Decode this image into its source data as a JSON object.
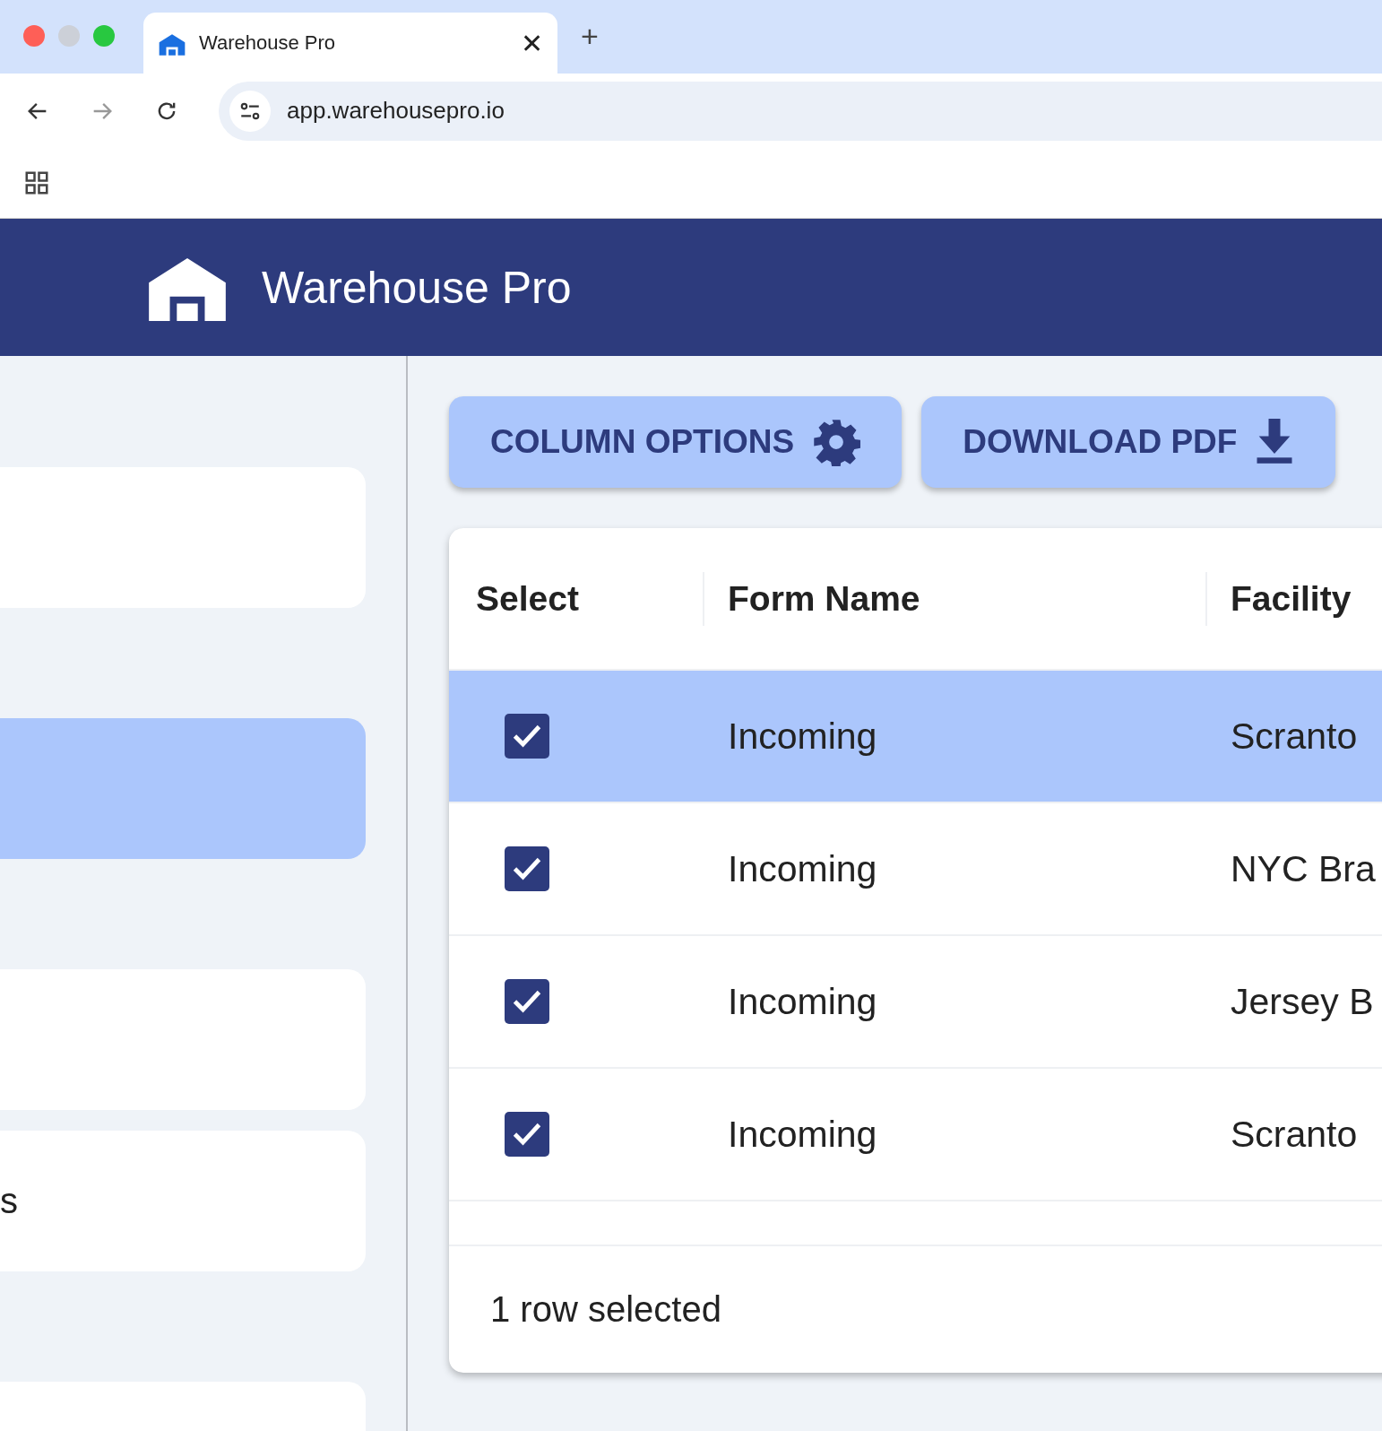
{
  "browser": {
    "tab": {
      "title": "Warehouse Pro",
      "close": "✕"
    },
    "new_tab": "+",
    "url": "app.warehousepro.io"
  },
  "header": {
    "title": "Warehouse Pro"
  },
  "sidebar": {
    "items": [
      {
        "selected": false
      },
      {
        "selected": true
      },
      {
        "selected": false
      },
      {
        "label": "s",
        "selected": false
      },
      {
        "selected": false
      }
    ]
  },
  "toolbar": {
    "buttons": [
      {
        "label": "COLUMN OPTIONS",
        "kind": "settings"
      },
      {
        "label": "DOWNLOAD PDF",
        "kind": "download"
      }
    ]
  },
  "table": {
    "columns": [
      "Select",
      "Form Name",
      "Facility"
    ],
    "rows": [
      {
        "checked": true,
        "selected": true,
        "form_name": "Incoming",
        "facility": "Scranto"
      },
      {
        "checked": true,
        "selected": false,
        "form_name": "Incoming",
        "facility": "NYC Bra"
      },
      {
        "checked": true,
        "selected": false,
        "form_name": "Incoming",
        "facility": "Jersey B"
      },
      {
        "checked": true,
        "selected": false,
        "form_name": "Incoming",
        "facility": "Scranto"
      }
    ],
    "footer": "1 row selected"
  }
}
